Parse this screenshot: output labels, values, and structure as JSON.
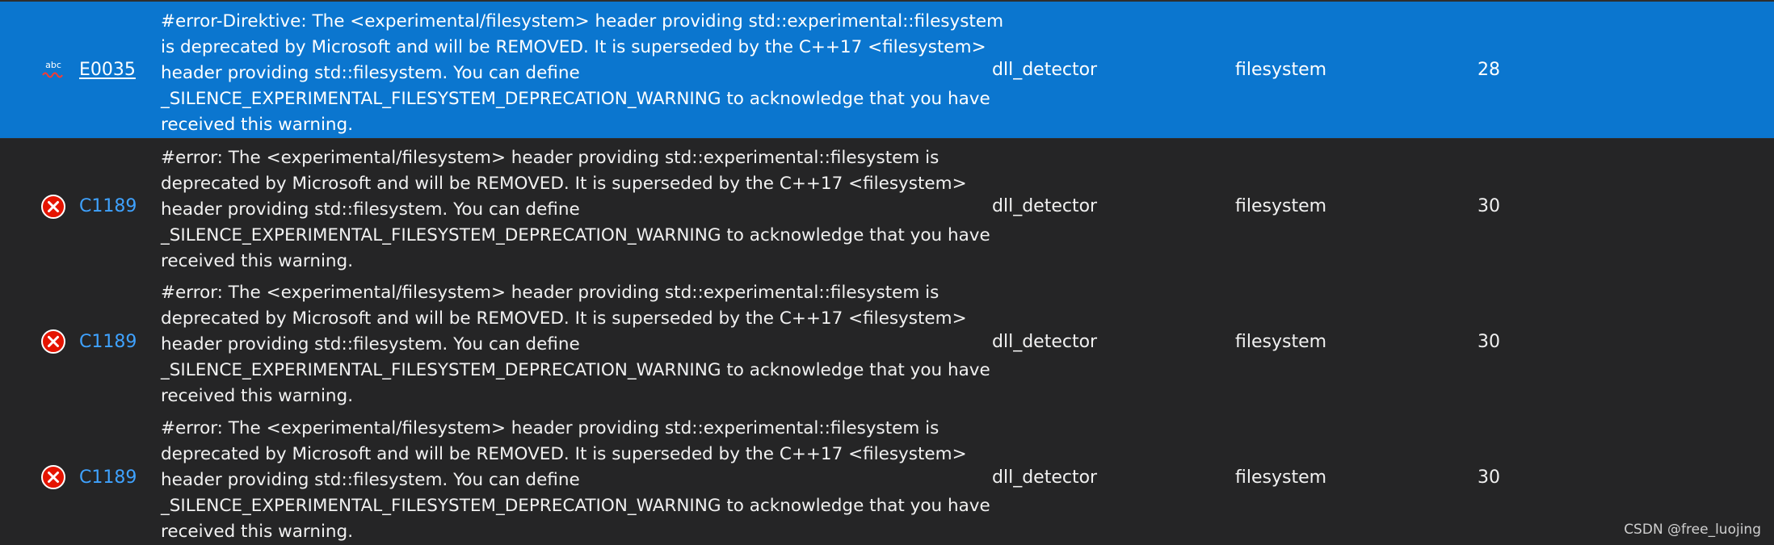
{
  "colors": {
    "background": "#252526",
    "selected_row": "#0b76cf",
    "error_icon": "#e51400",
    "code_link": "#3fa2ff"
  },
  "rows": [
    {
      "icon": "spellcheck-abc-icon",
      "icon_text": "abc",
      "code": "E0035",
      "description_lines": [
        "#error-Direktive: The <experimental/filesystem> header providing std::experimental::filesystem",
        "is deprecated by Microsoft and will be REMOVED. It is superseded by the C++17 <filesystem>",
        "header providing std::filesystem. You can define",
        "_SILENCE_EXPERIMENTAL_FILESYSTEM_DEPRECATION_WARNING to acknowledge that you have",
        "received this warning."
      ],
      "project": "dll_detector",
      "file": "filesystem",
      "line": "28"
    },
    {
      "icon": "error-icon",
      "code": "C1189",
      "description_lines": [
        "#error:  The <experimental/filesystem> header providing std::experimental::filesystem is",
        "deprecated by Microsoft and will be REMOVED. It is superseded by the C++17 <filesystem>",
        "header providing std::filesystem. You can define",
        "_SILENCE_EXPERIMENTAL_FILESYSTEM_DEPRECATION_WARNING to acknowledge that you have",
        "received this warning."
      ],
      "project": "dll_detector",
      "file": "filesystem",
      "line": "30"
    },
    {
      "icon": "error-icon",
      "code": "C1189",
      "description_lines": [
        "#error:  The <experimental/filesystem> header providing std::experimental::filesystem is",
        "deprecated by Microsoft and will be REMOVED. It is superseded by the C++17 <filesystem>",
        "header providing std::filesystem. You can define",
        "_SILENCE_EXPERIMENTAL_FILESYSTEM_DEPRECATION_WARNING to acknowledge that you have",
        "received this warning."
      ],
      "project": "dll_detector",
      "file": "filesystem",
      "line": "30"
    },
    {
      "icon": "error-icon",
      "code": "C1189",
      "description_lines": [
        "#error:  The <experimental/filesystem> header providing std::experimental::filesystem is",
        "deprecated by Microsoft and will be REMOVED. It is superseded by the C++17 <filesystem>",
        "header providing std::filesystem. You can define",
        "_SILENCE_EXPERIMENTAL_FILESYSTEM_DEPRECATION_WARNING to acknowledge that you have",
        "received this warning."
      ],
      "project": "dll_detector",
      "file": "filesystem",
      "line": "30"
    }
  ],
  "watermark": "CSDN @free_luojing"
}
